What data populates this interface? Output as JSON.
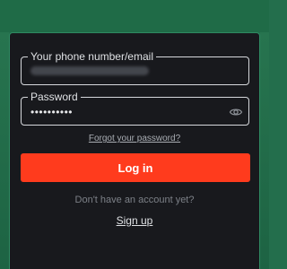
{
  "form": {
    "identity_label": "Your phone number/email",
    "password_label": "Password",
    "password_value": "••••••••••",
    "forgot_label": "Forgot your password?",
    "login_label": "Log in",
    "no_account_text": "Don't have an account yet?",
    "signup_label": "Sign up"
  },
  "colors": {
    "background": "#236e4c",
    "panel": "#18191d",
    "accent": "#ff3b1d"
  },
  "icons": {
    "show_password": "eye-icon"
  }
}
